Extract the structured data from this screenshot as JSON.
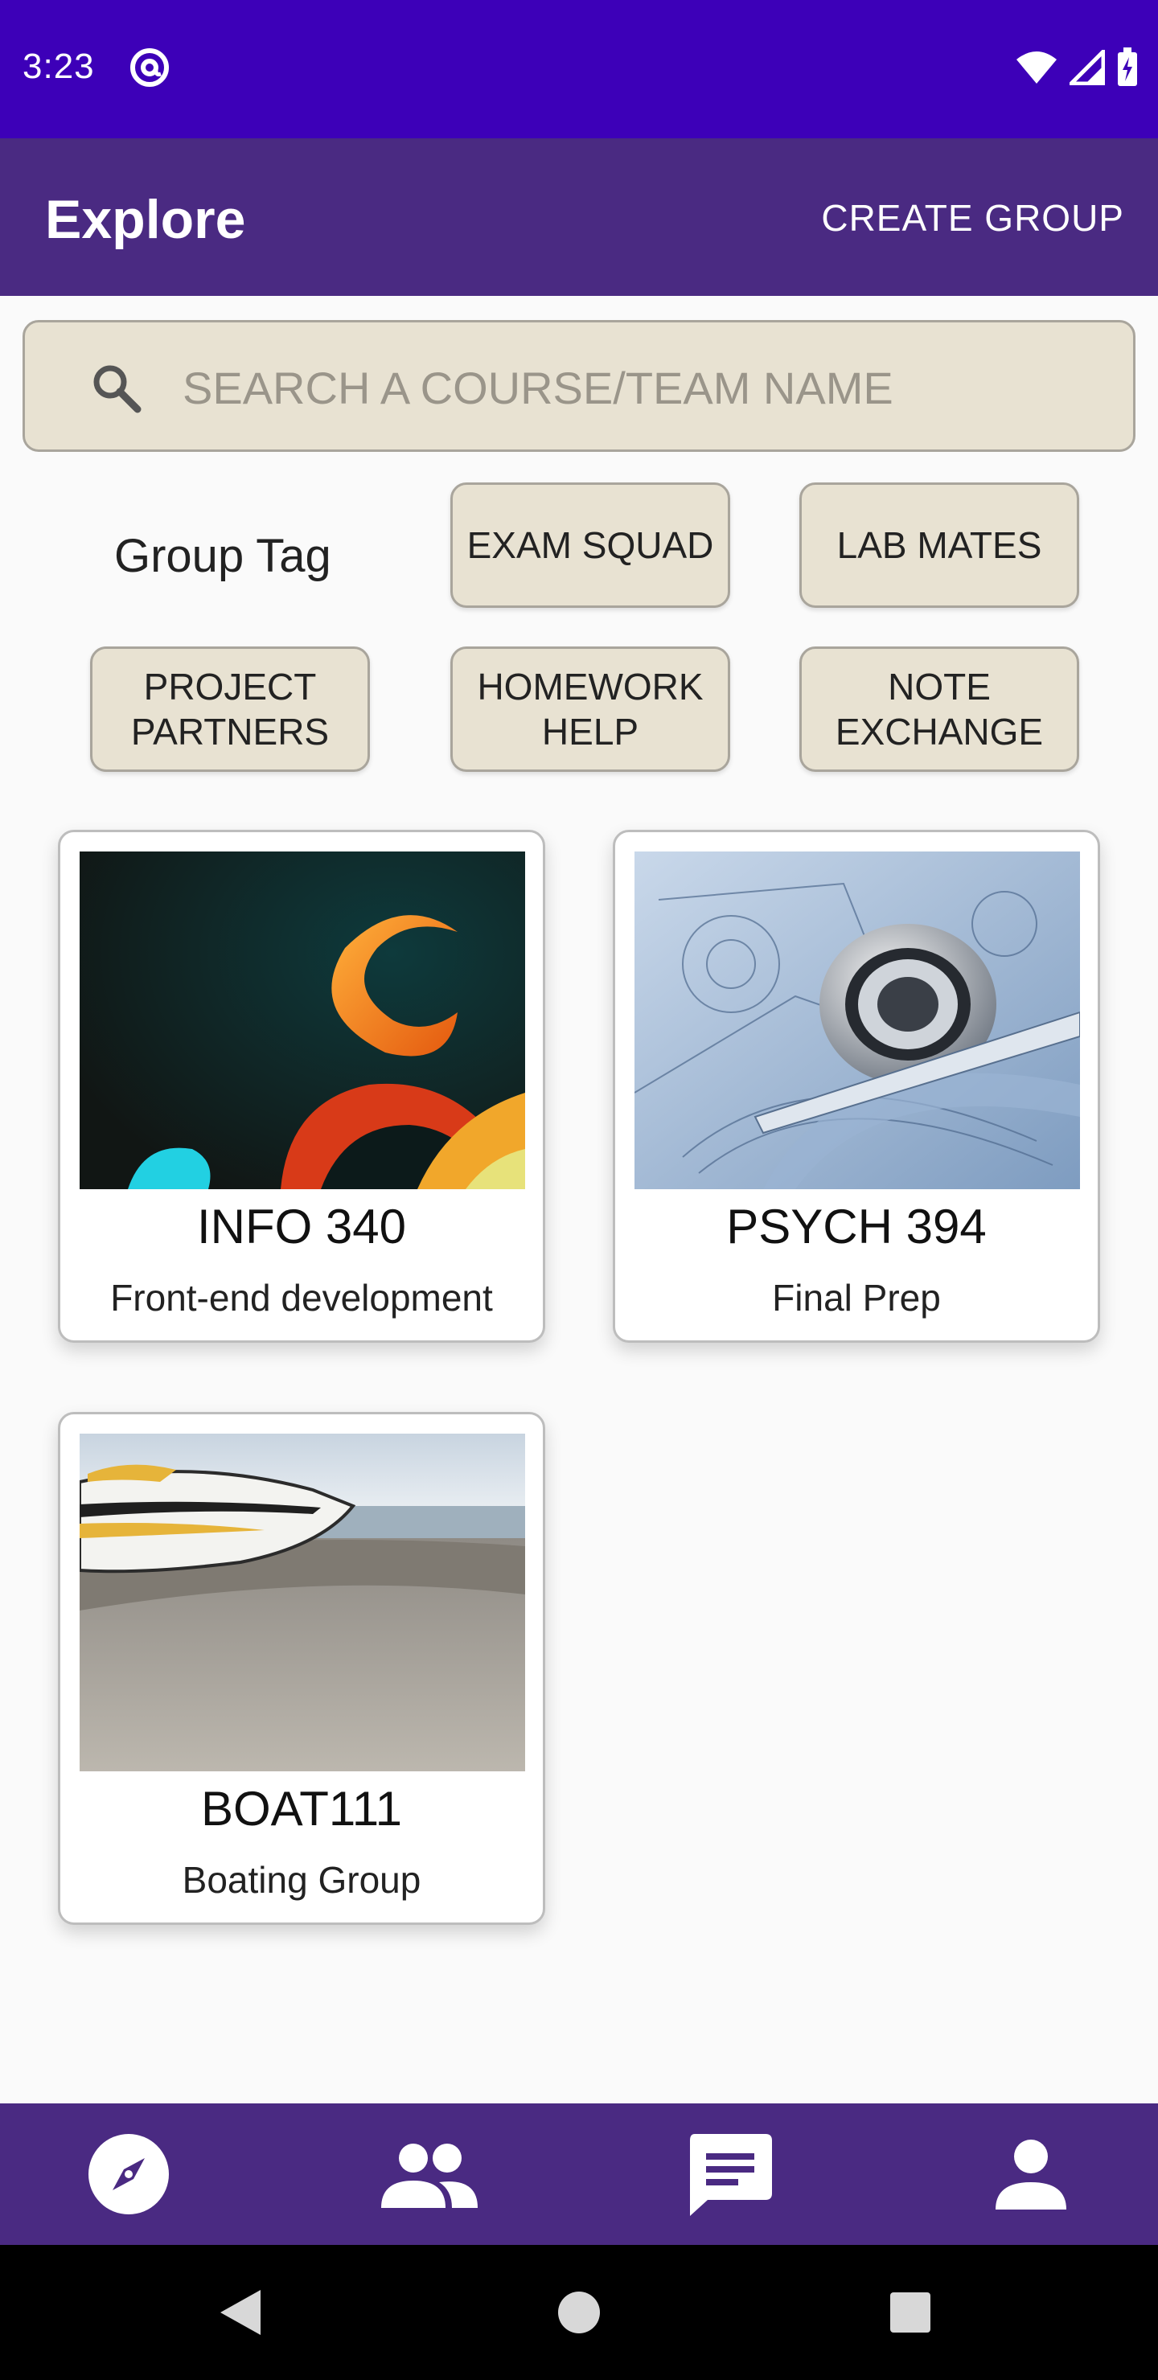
{
  "status_bar": {
    "time": "3:23"
  },
  "app_bar": {
    "title": "Explore",
    "action_label": "CREATE GROUP"
  },
  "search": {
    "placeholder": "SEARCH A COURSE/TEAM NAME"
  },
  "group_tags": {
    "label": "Group Tag",
    "tags": [
      "EXAM SQUAD",
      "LAB MATES",
      "PROJECT PARTNERS",
      "HOMEWORK HELP",
      "NOTE EXCHANGE"
    ]
  },
  "groups": [
    {
      "course": "INFO 340",
      "description": "Front-end development",
      "image": "abstract-orange-swirl-image"
    },
    {
      "course": "PSYCH 394",
      "description": "Final Prep",
      "image": "engineering-bearing-image"
    },
    {
      "course": "BOAT111",
      "description": "Boating Group",
      "image": "boat-on-beach-image"
    }
  ],
  "bottom_nav": {
    "items": [
      {
        "icon": "explore-compass-icon",
        "active": true
      },
      {
        "icon": "groups-icon",
        "active": false
      },
      {
        "icon": "chat-icon",
        "active": false
      },
      {
        "icon": "profile-icon",
        "active": false
      }
    ]
  },
  "colors": {
    "status_bar": "#3d00b8",
    "app_bar": "#4a2a82",
    "tag_background": "#e8e2d2",
    "background": "#fafafa"
  }
}
